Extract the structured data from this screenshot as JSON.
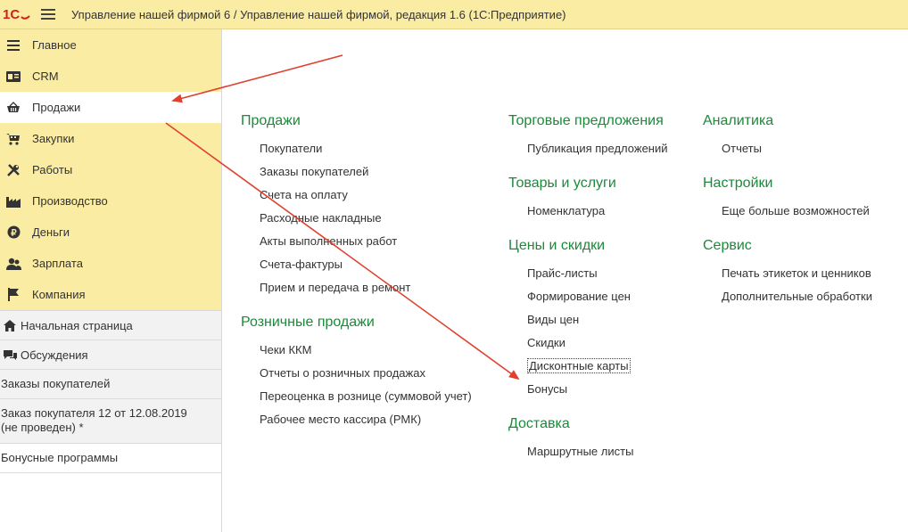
{
  "app": {
    "title": "Управление нашей фирмой 6 / Управление нашей фирмой, редакция 1.6  (1С:Предприятие)",
    "accent_color": "#fbeca4",
    "group_color": "#1b8a3a"
  },
  "sections": [
    {
      "label": "Главное",
      "icon": "menu-list-icon"
    },
    {
      "label": "CRM",
      "icon": "crm-card-icon"
    },
    {
      "label": "Продажи",
      "icon": "basket-icon",
      "active": true
    },
    {
      "label": "Закупки",
      "icon": "cart-icon"
    },
    {
      "label": "Работы",
      "icon": "tools-icon"
    },
    {
      "label": "Производство",
      "icon": "factory-icon"
    },
    {
      "label": "Деньги",
      "icon": "ruble-coin-icon"
    },
    {
      "label": "Зарплата",
      "icon": "people-icon"
    },
    {
      "label": "Компания",
      "icon": "flag-icon"
    }
  ],
  "nav": {
    "home": "Начальная страница",
    "discussions": "Обсуждения"
  },
  "open_windows": [
    "Заказы покупателей",
    "Заказ покупателя 12 от 12.08.2019\n(не проведен) *",
    "Бонусные программы"
  ],
  "groups": {
    "sales": {
      "title": "Продажи",
      "items": [
        "Покупатели",
        "Заказы покупателей",
        "Счета на оплату",
        "Расходные накладные",
        "Акты выполненных работ",
        "Счета-фактуры",
        "Прием и передача в ремонт"
      ]
    },
    "retail": {
      "title": "Розничные продажи",
      "items": [
        "Чеки ККМ",
        "Отчеты о розничных продажах",
        "Переоценка в рознице (суммовой учет)",
        "Рабочее место кассира (РМК)"
      ]
    },
    "offers": {
      "title": "Торговые предложения",
      "items": [
        "Публикация предложений"
      ]
    },
    "goods": {
      "title": "Товары и услуги",
      "items": [
        "Номенклатура"
      ]
    },
    "prices": {
      "title": "Цены и скидки",
      "items": [
        "Прайс-листы",
        "Формирование цен",
        "Виды цен",
        "Скидки",
        "Дисконтные карты",
        "Бонусы"
      ]
    },
    "delivery": {
      "title": "Доставка",
      "items": [
        "Маршрутные листы"
      ]
    },
    "analytics": {
      "title": "Аналитика",
      "items": [
        "Отчеты"
      ]
    },
    "settings": {
      "title": "Настройки",
      "items": [
        "Еще больше возможностей"
      ]
    },
    "service": {
      "title": "Сервис",
      "items": [
        "Печать этикеток и ценников",
        "Дополнительные обработки"
      ]
    }
  }
}
